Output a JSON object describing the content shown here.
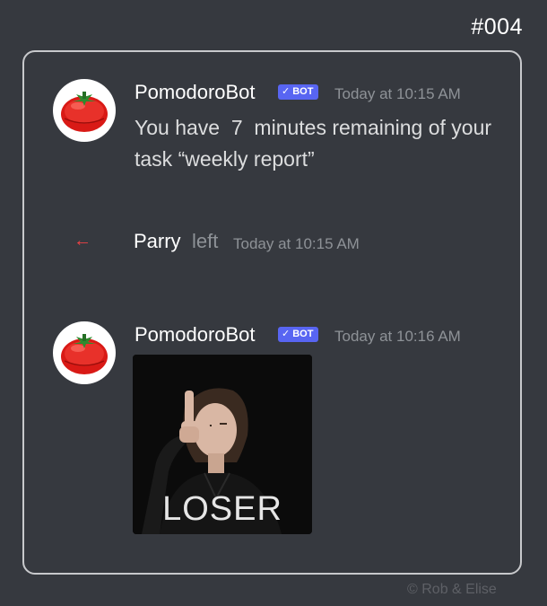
{
  "page_number": "#004",
  "messages": [
    {
      "author": "PomodoroBot",
      "badge": "BOT",
      "badge_check": "✓",
      "timestamp": "Today at 10:15 AM",
      "text": "You have  7  minutes remaining of your task “weekly report”"
    },
    {
      "author": "PomodoroBot",
      "badge": "BOT",
      "badge_check": "✓",
      "timestamp": "Today at 10:16 AM",
      "gif_caption": "LOSER"
    }
  ],
  "system_event": {
    "arrow": "←",
    "user": "Parry",
    "action": "left",
    "timestamp": "Today at 10:15 AM"
  },
  "credit": "©   Rob & Elise",
  "colors": {
    "background": "#36393f",
    "bot_badge": "#5865f2",
    "leave_arrow": "#ed4245"
  }
}
